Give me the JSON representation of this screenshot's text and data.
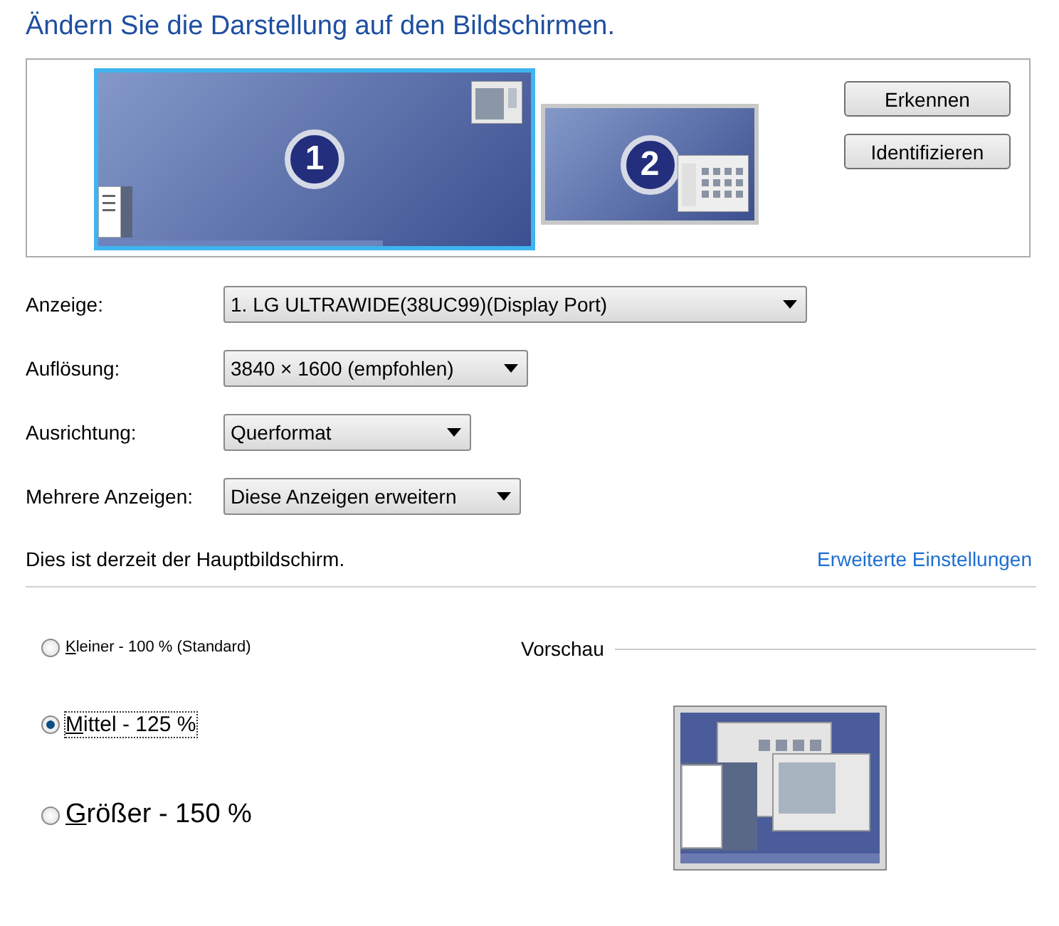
{
  "title": "Ändern Sie die Darstellung auf den Bildschirmen.",
  "monitors": [
    {
      "number": "1",
      "selected": true
    },
    {
      "number": "2",
      "selected": false
    }
  ],
  "monitor_buttons": [
    "Erkennen",
    "Identifizieren"
  ],
  "settings": [
    {
      "label": "Anzeige:",
      "value": "1. LG ULTRAWIDE(38UC99)(Display Port)"
    },
    {
      "label": "Auflösung:",
      "value": "3840 × 1600 (empfohlen)"
    },
    {
      "label": "Ausrichtung:",
      "value": "Querformat"
    },
    {
      "label": "Mehrere Anzeigen:",
      "value": "Diese Anzeigen erweitern"
    }
  ],
  "info": "Dies ist derzeit der Hauptbildschirm.",
  "advanced_link": "Erweiterte Einstellungen",
  "scale_options": [
    {
      "access_key": "K",
      "rest": "leiner - 100 % (Standard)",
      "selected": false
    },
    {
      "access_key": "M",
      "rest": "ittel - 125 %",
      "selected": true
    },
    {
      "access_key": "G",
      "rest": "rößer - 150 %",
      "selected": false
    }
  ],
  "preview_label": "Vorschau"
}
